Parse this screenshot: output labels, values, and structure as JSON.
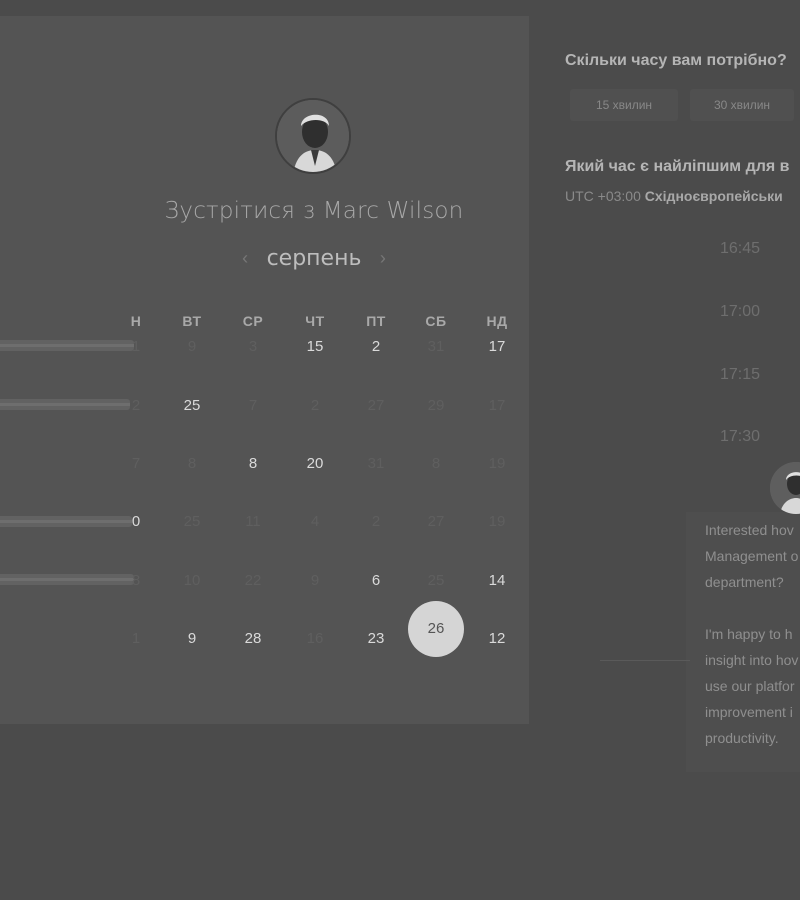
{
  "scheduler": {
    "title": "Зустрітися з Marc Wilson",
    "month": "серпень",
    "weekdays": [
      "Н",
      "ВТ",
      "СР",
      "ЧТ",
      "ПТ",
      "СБ",
      "НД"
    ],
    "weeks": [
      [
        {
          "d": "1",
          "m": true
        },
        {
          "d": "9",
          "m": true
        },
        {
          "d": "3",
          "m": true
        },
        {
          "d": "15",
          "m": false
        },
        {
          "d": "2",
          "m": false
        },
        {
          "d": "31",
          "m": true
        },
        {
          "d": "17",
          "m": false
        }
      ],
      [
        {
          "d": "2",
          "m": true
        },
        {
          "d": "25",
          "m": false
        },
        {
          "d": "7",
          "m": true
        },
        {
          "d": "2",
          "m": true
        },
        {
          "d": "27",
          "m": true
        },
        {
          "d": "29",
          "m": true
        },
        {
          "d": "17",
          "m": true
        }
      ],
      [
        {
          "d": "7",
          "m": true
        },
        {
          "d": "8",
          "m": true
        },
        {
          "d": "8",
          "m": false
        },
        {
          "d": "20",
          "m": false
        },
        {
          "d": "31",
          "m": true
        },
        {
          "d": "8",
          "m": true
        },
        {
          "d": "19",
          "m": true
        }
      ],
      [
        {
          "d": "0",
          "m": false
        },
        {
          "d": "25",
          "m": true
        },
        {
          "d": "11",
          "m": true
        },
        {
          "d": "4",
          "m": true
        },
        {
          "d": "2",
          "m": true
        },
        {
          "d": "27",
          "m": true
        },
        {
          "d": "19",
          "m": true
        }
      ],
      [
        {
          "d": "8",
          "m": true
        },
        {
          "d": "10",
          "m": true
        },
        {
          "d": "22",
          "m": true
        },
        {
          "d": "9",
          "m": true
        },
        {
          "d": "6",
          "m": false
        },
        {
          "d": "25",
          "m": true
        },
        {
          "d": "14",
          "m": false
        }
      ],
      [
        {
          "d": "1",
          "m": true
        },
        {
          "d": "9",
          "m": false
        },
        {
          "d": "28",
          "m": false
        },
        {
          "d": "16",
          "m": true
        },
        {
          "d": "23",
          "m": false
        },
        {
          "d": "26",
          "m": false,
          "sel": true
        },
        {
          "d": "12",
          "m": false
        }
      ]
    ],
    "selected_day": "26"
  },
  "duration": {
    "question": "Скільки часу вам потрібно?",
    "options": [
      "15 хвилин",
      "30 хвилин"
    ]
  },
  "time": {
    "question": "Який час є найліпшим для в",
    "tz_offset": "UTC +03:00",
    "tz_name": "Східноєвропейськи",
    "slots": [
      "16:45",
      "17:00",
      "17:15",
      "17:30"
    ]
  },
  "chat": {
    "lines": [
      "Interested hov",
      "Management o",
      "department?",
      "",
      "I'm happy to h",
      "insight into hov",
      "use our platfor",
      "improvement i",
      "productivity."
    ]
  },
  "colors": {
    "page_bg": "#4b4b4b",
    "card_bg": "#545454",
    "selected_day_bg": "#d5d5d5"
  },
  "icons": {
    "prev": "chevron-left-icon",
    "next": "chevron-right-icon"
  }
}
